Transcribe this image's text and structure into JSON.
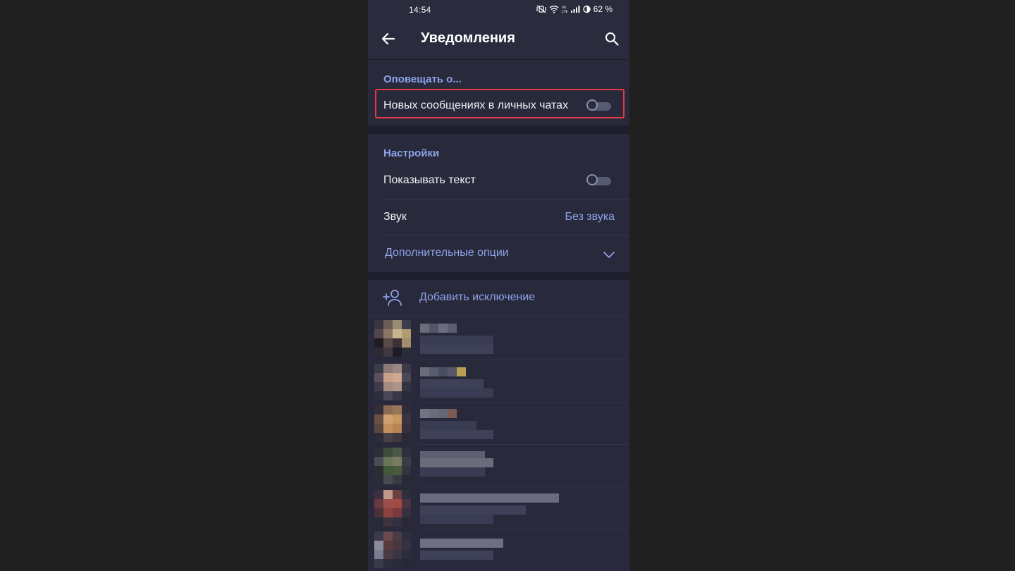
{
  "status_bar": {
    "time": "14:54",
    "battery": "62 %",
    "icons": [
      "mute-vibrate-icon",
      "wifi-icon",
      "volte-icon",
      "signal-icon",
      "battery-icon"
    ]
  },
  "app_bar": {
    "title": "Уведомления",
    "back_icon": "arrow-left-icon",
    "search_icon": "search-icon"
  },
  "notify_section": {
    "header": "Оповещать о...",
    "new_messages_label": "Новых сообщениях в личных чатах",
    "new_messages_enabled": false
  },
  "settings_section": {
    "header": "Настройки",
    "show_text_label": "Показывать текст",
    "show_text_enabled": false,
    "sound_label": "Звук",
    "sound_value": "Без звука",
    "more_options_label": "Дополнительные опции"
  },
  "exceptions": {
    "add_label": "Добавить исключение",
    "add_icon": "add-person-icon"
  },
  "colors": {
    "background": "#282a3b",
    "accent": "#8da2ea",
    "highlight": "#e53945"
  }
}
